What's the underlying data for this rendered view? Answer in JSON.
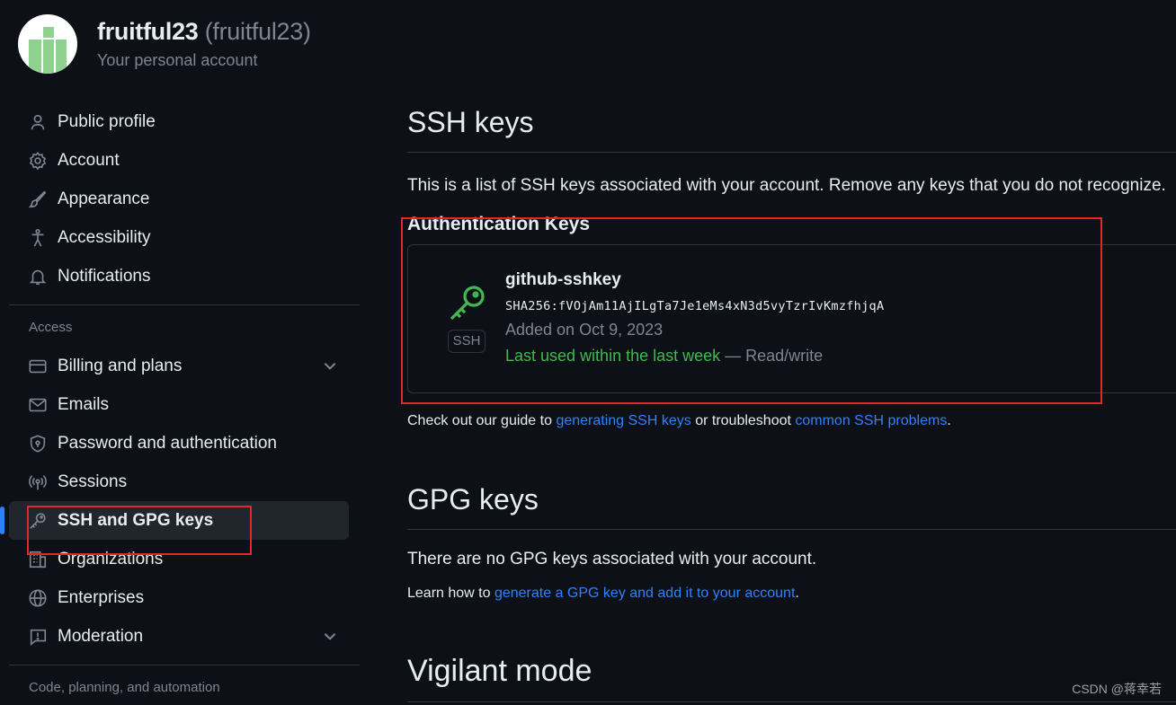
{
  "header": {
    "name": "fruitful23",
    "login": "(fruitful23)",
    "subtitle": "Your personal account"
  },
  "sidebar": {
    "items": [
      {
        "label": "Public profile",
        "icon": "person-icon"
      },
      {
        "label": "Account",
        "icon": "gear-icon"
      },
      {
        "label": "Appearance",
        "icon": "paintbrush-icon"
      },
      {
        "label": "Accessibility",
        "icon": "accessibility-icon"
      },
      {
        "label": "Notifications",
        "icon": "bell-icon"
      }
    ],
    "access_title": "Access",
    "access_items": [
      {
        "label": "Billing and plans",
        "icon": "credit-card-icon",
        "expandable": true
      },
      {
        "label": "Emails",
        "icon": "mail-icon"
      },
      {
        "label": "Password and authentication",
        "icon": "shield-lock-icon"
      },
      {
        "label": "Sessions",
        "icon": "broadcast-icon"
      },
      {
        "label": "SSH and GPG keys",
        "icon": "key-icon",
        "active": true
      },
      {
        "label": "Organizations",
        "icon": "organization-icon"
      },
      {
        "label": "Enterprises",
        "icon": "globe-icon"
      },
      {
        "label": "Moderation",
        "icon": "report-icon",
        "expandable": true
      }
    ],
    "next_section_title": "Code, planning, and automation"
  },
  "main": {
    "ssh": {
      "title": "SSH keys",
      "description": "This is a list of SSH keys associated with your account. Remove any keys that you do not recognize.",
      "auth_heading": "Authentication Keys",
      "key": {
        "title": "github-sshkey",
        "fingerprint": "SHA256:fVOjAm11AjILgTa7Je1eMs4xN3d5vyTzrIvKmzfhjqA",
        "badge": "SSH",
        "added": "Added on Oct 9, 2023",
        "last_used": "Last used within the last week",
        "access": " — Read/write"
      },
      "guide_prefix": "Check out our guide to ",
      "guide_link1": "generating SSH keys",
      "guide_mid": " or troubleshoot ",
      "guide_link2": "common SSH problems",
      "guide_suffix": "."
    },
    "gpg": {
      "title": "GPG keys",
      "empty": "There are no GPG keys associated with your account.",
      "learn_prefix": "Learn how to ",
      "learn_link": "generate a GPG key and add it to your account",
      "learn_suffix": "."
    },
    "vigilant": {
      "title": "Vigilant mode"
    }
  },
  "watermark": "CSDN @蒋幸若",
  "colors": {
    "background": "#0d1117",
    "accent": "#2f81f7",
    "success": "#3fb950",
    "annotation": "#e0272a"
  }
}
